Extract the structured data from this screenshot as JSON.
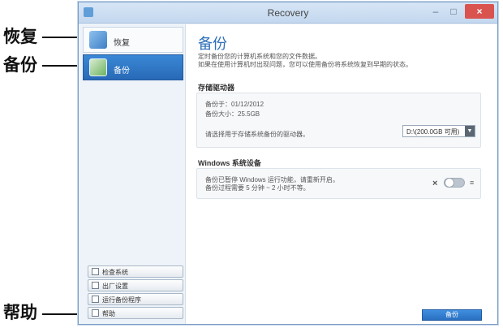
{
  "callouts": {
    "restore": "恢复",
    "backup": "备份",
    "help": "帮助"
  },
  "window": {
    "title": "Recovery",
    "minimize_glyph": "–",
    "maximize_glyph": "□",
    "close_glyph": "×"
  },
  "sidebar": {
    "items": [
      {
        "label": "恢复",
        "icon": "restore-icon"
      },
      {
        "label": "备份",
        "icon": "backup-icon"
      }
    ],
    "bottom_buttons": [
      {
        "label": "检查系统",
        "icon": "document-icon"
      },
      {
        "label": "出厂设置",
        "icon": "document-icon"
      },
      {
        "label": "运行备份程序",
        "icon": "document-icon"
      },
      {
        "label": "帮助",
        "icon": "help-icon"
      }
    ]
  },
  "main": {
    "title": "备份",
    "description": [
      "定时备份您的计算机系统和您的文件数据。",
      "如果在使用计算机时出现问题，您可以使用备份将系统恢复到早期的状态。"
    ],
    "storage": {
      "heading": "存储驱动器",
      "last_backup": "备份于：01/12/2012",
      "backup_size": "备份大小：25.5GB",
      "select_text": "请选择用于存储系统备份的驱动器。",
      "drive_value": "D:\\(200.0GB 可用)"
    },
    "windows_backup": {
      "heading": "Windows 系统设备",
      "line1": "备份已暂停 Windows 运行功能，请重新开启。",
      "line2": "备份过程需要 5 分钟 ~ 2 小时不等。",
      "toggle_off_label": "×",
      "toggle_on_label": "≡"
    },
    "primary_button": "备份"
  },
  "colors": {
    "accent": "#2a6fc0",
    "title_blue": "#2d6fb8",
    "close_red": "#d9534f"
  }
}
